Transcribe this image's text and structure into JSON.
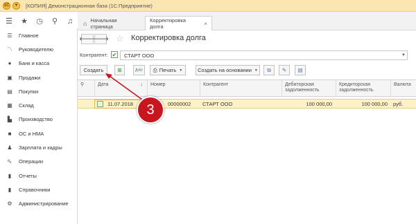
{
  "window": {
    "title": "[КОПИЯ] Демонстрационная база  (1С:Предприятие)"
  },
  "topbar": {
    "icons": [
      "menu-icon",
      "star-icon",
      "history-icon",
      "search-icon",
      "bell-icon"
    ]
  },
  "sidebar": {
    "items": [
      {
        "label": "Главное",
        "icon": "menu-icon"
      },
      {
        "label": "Руководителю",
        "icon": "chart-icon"
      },
      {
        "label": "Банк и касса",
        "icon": "coin-icon"
      },
      {
        "label": "Продажи",
        "icon": "bag-icon"
      },
      {
        "label": "Покупки",
        "icon": "basket-icon"
      },
      {
        "label": "Склад",
        "icon": "warehouse-icon"
      },
      {
        "label": "Производство",
        "icon": "factory-icon"
      },
      {
        "label": "ОС и НМА",
        "icon": "truck-icon"
      },
      {
        "label": "Зарплата и кадры",
        "icon": "person-icon"
      },
      {
        "label": "Операции",
        "icon": "operations-icon"
      },
      {
        "label": "Отчеты",
        "icon": "reports-icon"
      },
      {
        "label": "Справочники",
        "icon": "book-icon"
      },
      {
        "label": "Администрирование",
        "icon": "gear-icon"
      }
    ]
  },
  "tabs": {
    "home": "Начальная страница",
    "active": "Корректировка долга",
    "close": "×"
  },
  "form": {
    "title": "Корректировка долга",
    "kontragent_label": "Контрагент:",
    "kontragent_value": "СТАРТ ООО"
  },
  "toolbar": {
    "create": "Создать",
    "print": "Печать",
    "create_based": "Создать на основании",
    "dt_kt": "ДтКт"
  },
  "grid": {
    "columns": [
      "Дата",
      "Номер",
      "Контрагент",
      "Дебиторская задолженность",
      "Кредиторская задолженность",
      "Валюта"
    ],
    "rows": [
      {
        "date": "11.07.2018",
        "number": "00000002",
        "contractor": "СТАРТ ООО",
        "debit": "100 000,00",
        "credit": "100 000,00",
        "currency": "руб."
      }
    ]
  },
  "callout": {
    "number": "3"
  }
}
